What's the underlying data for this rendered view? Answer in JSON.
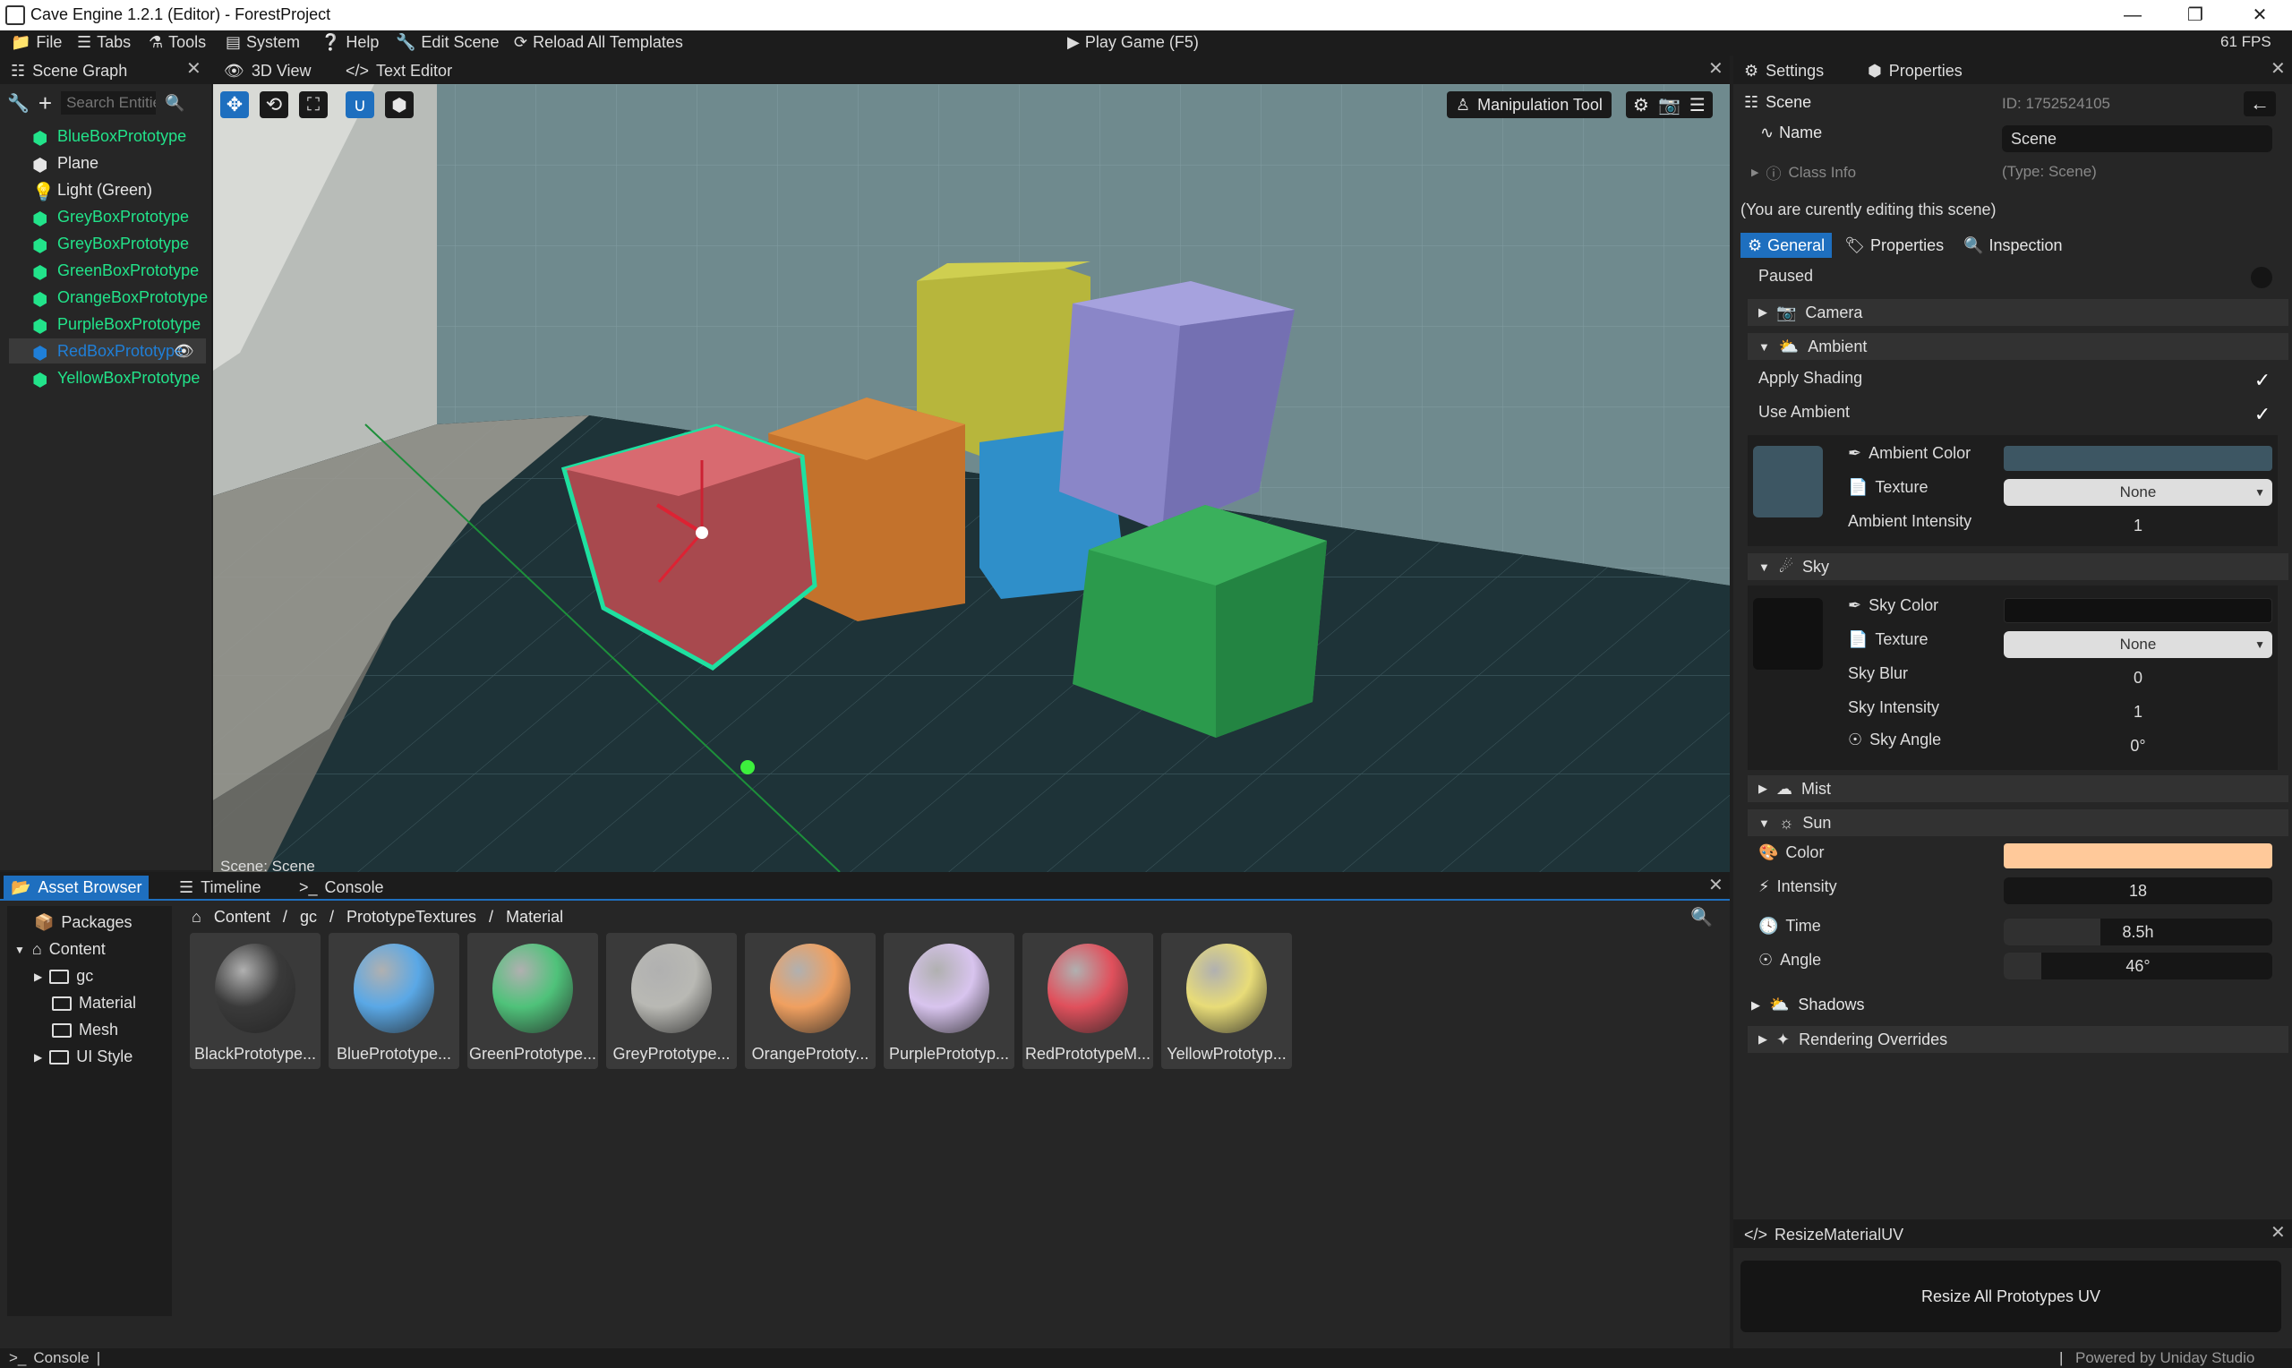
{
  "window": {
    "title": "Cave Engine 1.2.1 (Editor) - ForestProject"
  },
  "menubar": {
    "items": [
      "File",
      "Tabs",
      "Tools",
      "System",
      "Help",
      "Edit Scene",
      "Reload All Templates"
    ],
    "play": "Play Game (F5)",
    "fps": "61 FPS"
  },
  "scene_graph": {
    "tab": "Scene Graph",
    "search_placeholder": "Search Entities",
    "entities": [
      {
        "label": "BlueBoxPrototype",
        "color": "#22e38a"
      },
      {
        "label": "Plane",
        "color": "#e6e6e6"
      },
      {
        "label": "Light (Green)",
        "color": "#e6e6e6"
      },
      {
        "label": "GreyBoxPrototype",
        "color": "#22e38a"
      },
      {
        "label": "GreyBoxPrototype",
        "color": "#22e38a"
      },
      {
        "label": "GreenBoxPrototype",
        "color": "#22e38a"
      },
      {
        "label": "OrangeBoxPrototype",
        "color": "#22e38a"
      },
      {
        "label": "PurpleBoxPrototype",
        "color": "#22e38a"
      },
      {
        "label": "RedBoxPrototype",
        "color": "#1f7fd8"
      },
      {
        "label": "YellowBoxPrototype",
        "color": "#22e38a"
      }
    ]
  },
  "viewport": {
    "tabs": [
      "3D View",
      "Text Editor"
    ],
    "manipulation_tool": "Manipulation Tool",
    "status": "Scene: Scene"
  },
  "settings": {
    "tabs": [
      "Settings",
      "Properties"
    ],
    "scene_label": "Scene",
    "id": "ID: 1752524105",
    "name_label": "Name",
    "name_value": "Scene",
    "class_info": "Class Info",
    "class_type": "(Type: Scene)",
    "editing_note": "(You are curently editing this scene)",
    "subtabs": [
      "General",
      "Properties",
      "Inspection"
    ],
    "paused": "Paused",
    "camera": "Camera",
    "ambient": {
      "title": "Ambient",
      "apply_shading": "Apply Shading",
      "use_ambient": "Use Ambient",
      "color_label": "Ambient Color",
      "color": "#3d5663",
      "texture_label": "Texture",
      "texture_value": "None",
      "intensity_label": "Ambient Intensity",
      "intensity": "1"
    },
    "sky": {
      "title": "Sky",
      "color_label": "Sky Color",
      "color": "#111111",
      "texture_label": "Texture",
      "texture_value": "None",
      "blur_label": "Sky Blur",
      "blur": "0",
      "intensity_label": "Sky Intensity",
      "intensity": "1",
      "angle_label": "Sky Angle",
      "angle": "0°"
    },
    "mist": "Mist",
    "sun": {
      "title": "Sun",
      "color_label": "Color",
      "color": "#ffc99a",
      "intensity_label": "Intensity",
      "intensity": "18",
      "time_label": "Time",
      "time": "8.5h",
      "time_fill": 0.36,
      "angle_label": "Angle",
      "angle": "46°",
      "angle_fill": 0.14
    },
    "shadows": "Shadows",
    "rendering_overrides": "Rendering Overrides"
  },
  "script_panel": {
    "tab": "ResizeMaterialUV",
    "button": "Resize All Prototypes UV"
  },
  "asset_browser": {
    "tabs": [
      "Asset Browser",
      "Timeline",
      "Console"
    ],
    "tree": [
      "Packages",
      "Content",
      "gc",
      "Material",
      "Mesh",
      "UI Style"
    ],
    "breadcrumb": [
      "Content",
      "gc",
      "PrototypeTextures",
      "Material"
    ],
    "assets": [
      {
        "label": "BlackPrototype...",
        "color": "#3a3a3a"
      },
      {
        "label": "BluePrototype...",
        "color": "#5aa8e6"
      },
      {
        "label": "GreenPrototype...",
        "color": "#4fc27a"
      },
      {
        "label": "GreyPrototype...",
        "color": "#b9b9b4"
      },
      {
        "label": "OrangePrototy...",
        "color": "#f0a060"
      },
      {
        "label": "PurplePrototyp...",
        "color": "#d8c4ee"
      },
      {
        "label": "RedPrototypeM...",
        "color": "#e0505c"
      },
      {
        "label": "YellowPrototyp...",
        "color": "#e8dc78"
      }
    ]
  },
  "statusbar": {
    "console": "Console",
    "powered": "Powered by Uniday Studio"
  }
}
